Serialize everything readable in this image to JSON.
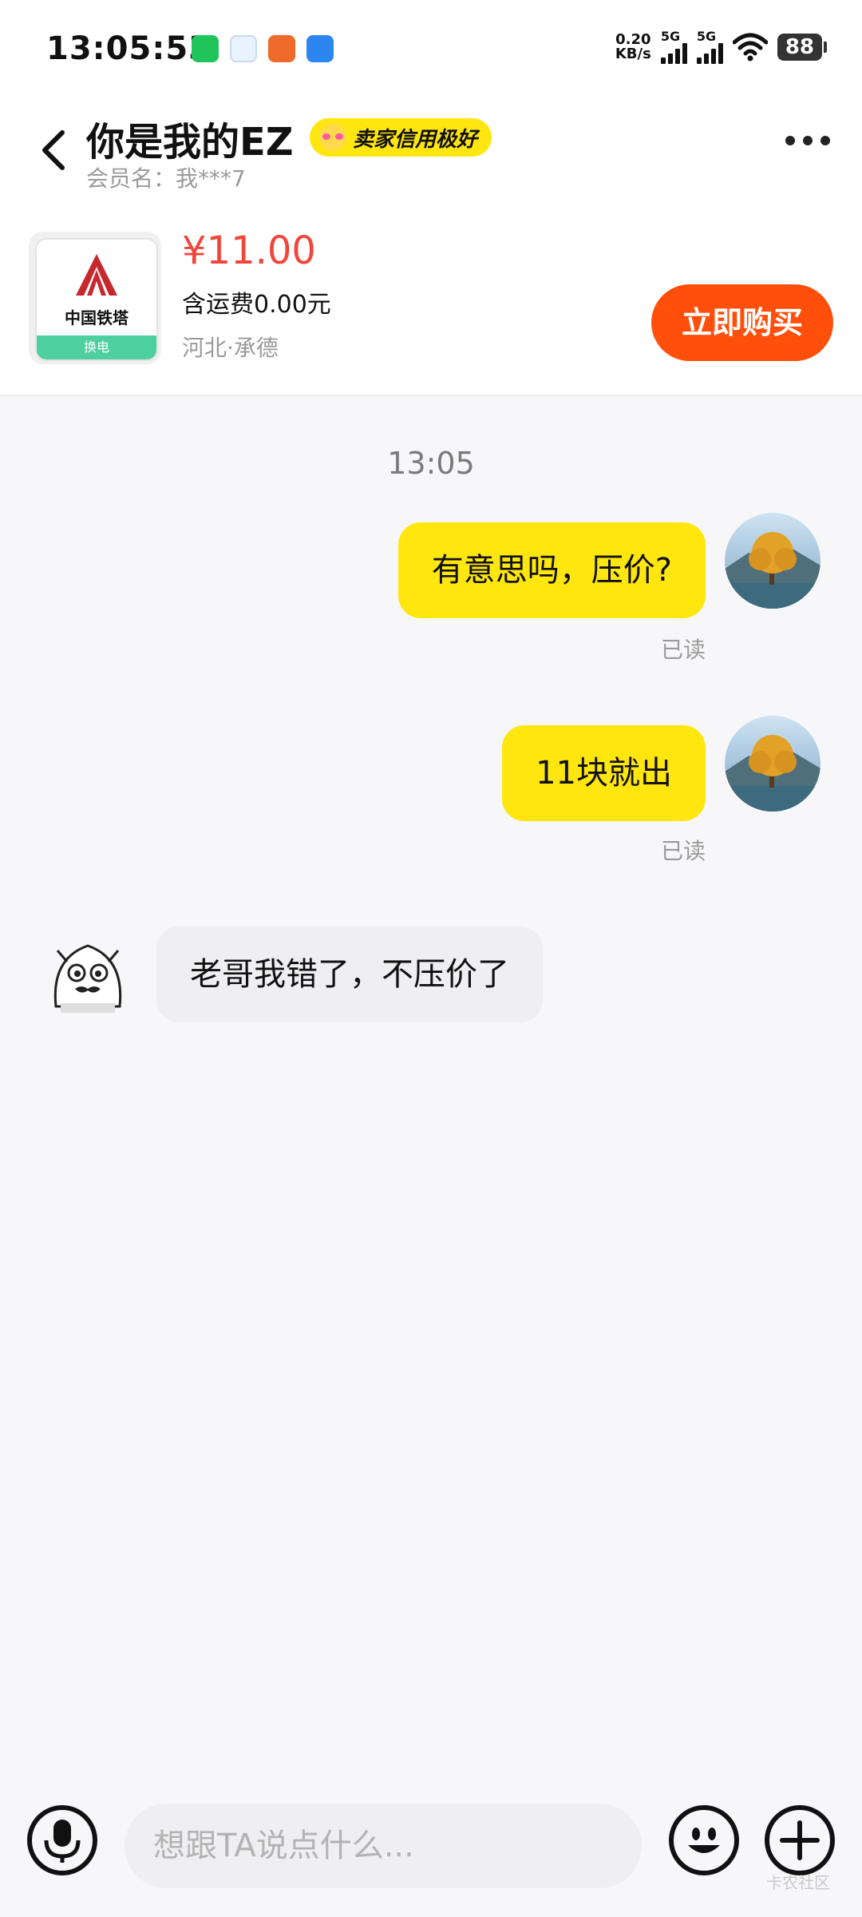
{
  "status_bar": {
    "time": "13:05:53",
    "net_speed_value": "0.20",
    "net_speed_unit": "KB/s",
    "signal_1_label": "5G",
    "signal_2_label": "5G",
    "battery": "88"
  },
  "header": {
    "title": "你是我的EZ",
    "badge": "卖家信用极好",
    "member_name": "会员名：我***7"
  },
  "product": {
    "thumb_name": "中国铁塔",
    "thumb_footer": "换电",
    "price": "¥11.00",
    "shipping": "含运费0.00元",
    "location": "河北·承德",
    "buy_label": "立即购买"
  },
  "chat": {
    "time_separator": "13:05",
    "messages": [
      {
        "text": "有意思吗，压价?",
        "status": "已读"
      },
      {
        "text": "11块就出",
        "status": "已读"
      },
      {
        "text": "老哥我错了，不压价了"
      }
    ]
  },
  "input": {
    "placeholder": "想跟TA说点什么..."
  },
  "watermark": "卡农社区"
}
